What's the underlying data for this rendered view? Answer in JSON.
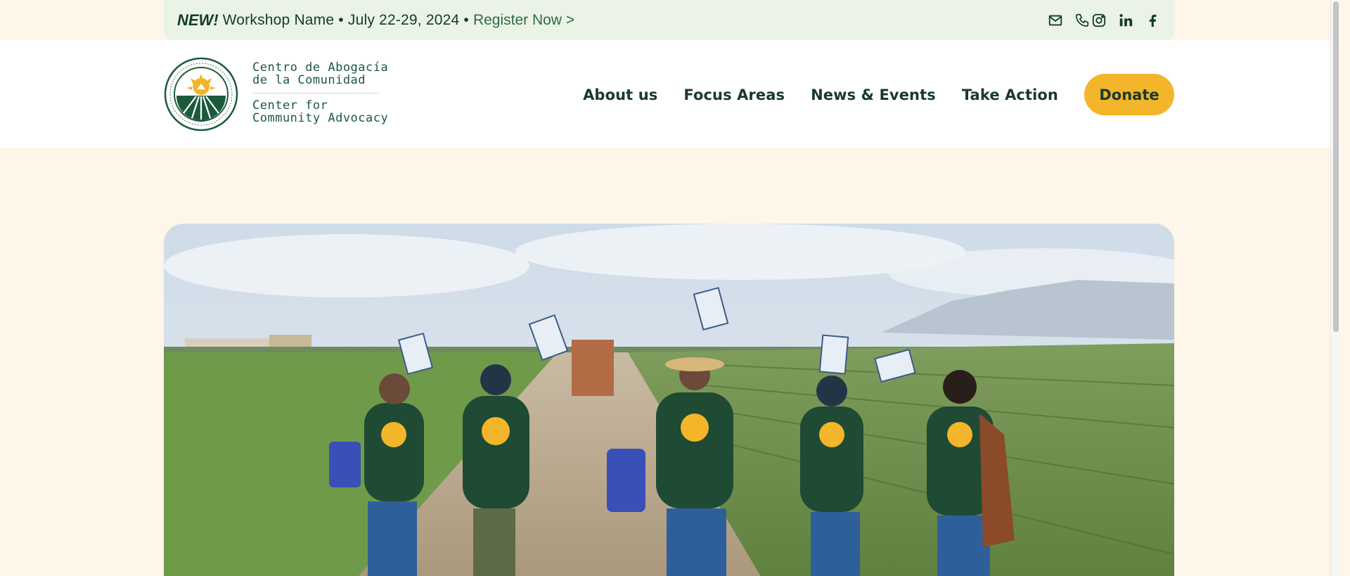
{
  "announcement": {
    "tag": "NEW!",
    "message": "Workshop Name • July 22-29, 2024 •",
    "cta": "Register Now >"
  },
  "social_icons": [
    "mail-icon",
    "phone-icon",
    "instagram-icon",
    "linkedin-icon",
    "facebook-icon"
  ],
  "brand": {
    "line1": "Centro de Abogacía",
    "line2": "de la Comunidad",
    "line3": "Center for",
    "line4": "Community Advocacy"
  },
  "nav": {
    "items": [
      "About us",
      "Focus Areas",
      "News & Events",
      "Take Action"
    ],
    "donate": "Donate"
  },
  "colors": {
    "background": "#fdf6e9",
    "announcement_bg": "#eaf3e6",
    "brand_green": "#1c5a3c",
    "text_dark": "#183a2c",
    "donate_yellow": "#f3b52a"
  }
}
